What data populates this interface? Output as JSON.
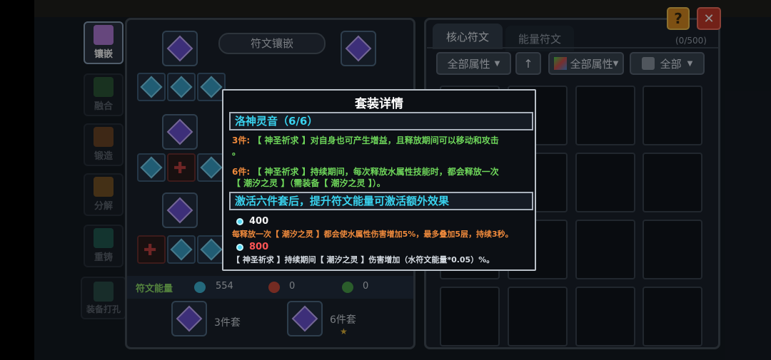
{
  "sidebar": {
    "items": [
      {
        "label": "镶嵌",
        "active": true
      },
      {
        "label": "融合"
      },
      {
        "label": "锻造"
      },
      {
        "label": "分解"
      },
      {
        "label": "重铸"
      },
      {
        "label": "装备打孔"
      }
    ]
  },
  "top_buttons": {
    "help": "?",
    "close": "✕"
  },
  "left_panel": {
    "title": "符文镶嵌",
    "energy_label": "符文能量",
    "energy": [
      {
        "icon": "water-gem-icon",
        "value": "554"
      },
      {
        "icon": "fire-gem-icon",
        "value": "0"
      },
      {
        "icon": "earth-gem-icon",
        "value": "0"
      }
    ],
    "set_buttons": [
      {
        "label": "3件套"
      },
      {
        "label": "6件套"
      }
    ]
  },
  "right_panel": {
    "tabs": [
      "核心符文",
      "能量符文"
    ],
    "count": "(0/500)",
    "filters": {
      "attr": "全部属性",
      "attr2": "全部属性",
      "all": "全部"
    }
  },
  "modal": {
    "title": "套装详情",
    "set_name": "洛神灵音（6/6）",
    "bonus3_prefix": "3件:",
    "bonus3_text": "【 神圣祈求 】对自身也可产生增益，且释放期间可以移动和攻击",
    "bonus3_tail": "。",
    "bonus6_prefix": "6件:",
    "bonus6_text": "【 神圣祈求 】持续期间，每次释放水属性技能时，都会释放一次",
    "bonus6_text2": "【 潮汐之灵 】（需装备【 潮汐之灵 】）。",
    "extra_head": "激活六件套后，提升符文能量可激活额外效果",
    "tier1_value": "400",
    "tier1_text": "每释放一次【 潮汐之灵 】都会使水属性伤害增加5%，最多叠加5层，持续3秒。",
    "tier2_value": "800",
    "tier2_text": "【 神圣祈求 】持续期间【 潮汐之灵 】伤害增加（水符文能量*0.05）%。"
  }
}
